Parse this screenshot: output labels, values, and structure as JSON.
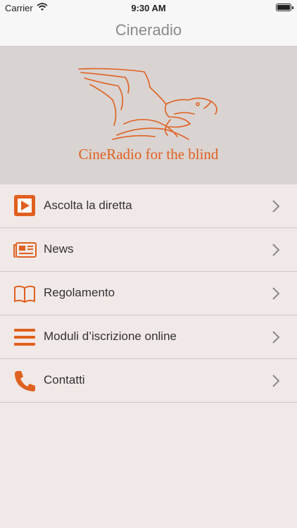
{
  "status_bar": {
    "carrier": "Carrier",
    "time": "9:30 AM"
  },
  "nav": {
    "title": "Cineradio"
  },
  "banner": {
    "logo_text": "CineRadio for the blind",
    "accent_color": "#e0601f"
  },
  "menu": {
    "items": [
      {
        "label": "Ascolta la diretta",
        "icon": "play-icon"
      },
      {
        "label": "News",
        "icon": "newspaper-icon"
      },
      {
        "label": "Regolamento",
        "icon": "book-icon"
      },
      {
        "label": "Moduli d’iscrizione online",
        "icon": "list-icon"
      },
      {
        "label": "Contatti",
        "icon": "phone-icon"
      }
    ]
  }
}
